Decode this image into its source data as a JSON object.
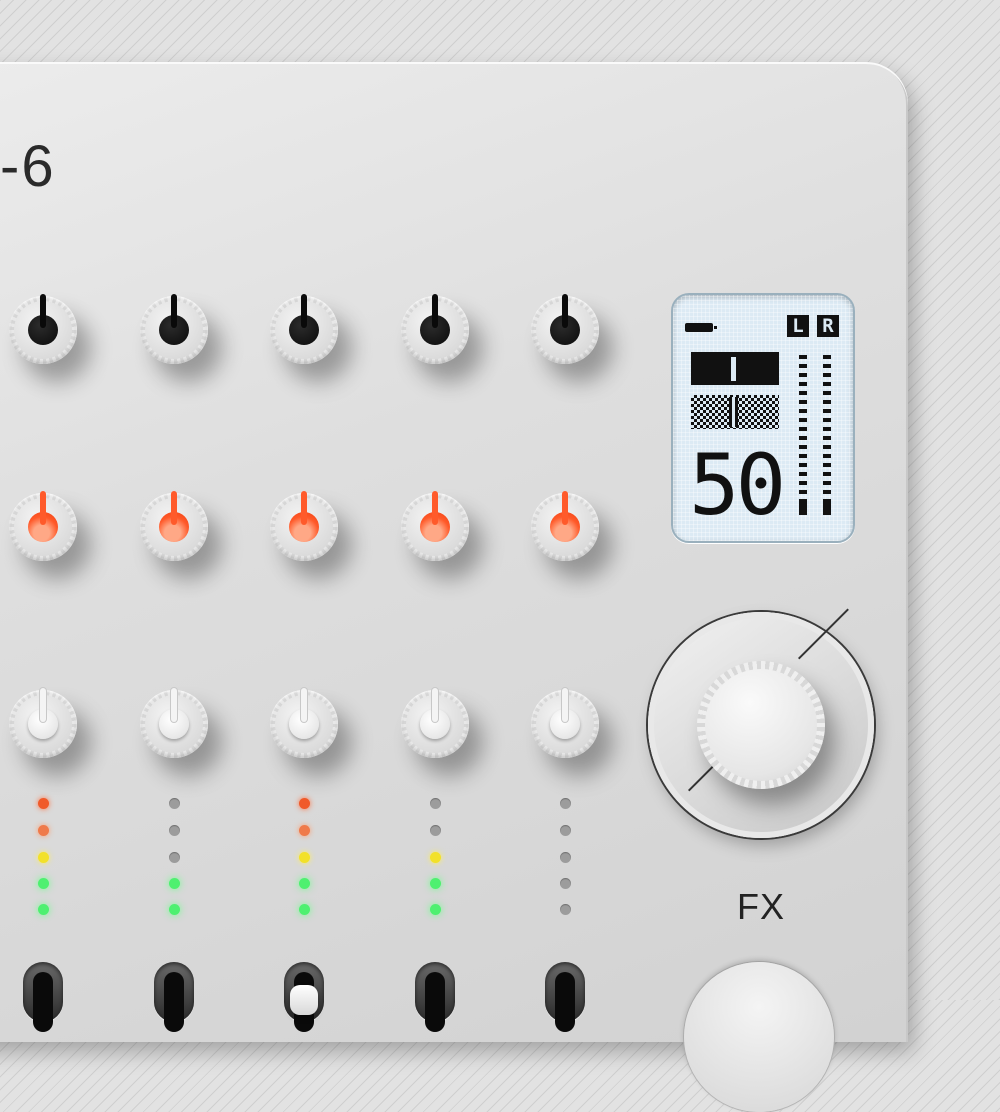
{
  "device": {
    "model_label": "-6",
    "fx_label": "FX"
  },
  "display": {
    "value": "50",
    "left_channel": "L",
    "right_channel": "R"
  },
  "knob_rows": [
    {
      "color": "black",
      "count": 5
    },
    {
      "color": "orange",
      "count": 5
    },
    {
      "color": "white",
      "count": 5
    }
  ],
  "level_meters": [
    [
      "red",
      "orange",
      "yellow",
      "green",
      "green"
    ],
    [
      "off",
      "off",
      "off",
      "green",
      "green"
    ],
    [
      "red",
      "orange",
      "yellow",
      "green",
      "green"
    ],
    [
      "off",
      "off",
      "yellow",
      "green",
      "green"
    ],
    [
      "off",
      "off",
      "off",
      "off",
      "off"
    ]
  ],
  "colors": {
    "accent_orange": "#ff5a2a",
    "led_green": "#4ef070",
    "led_yellow": "#f2e12a",
    "display_bg": "#dceaf4"
  }
}
